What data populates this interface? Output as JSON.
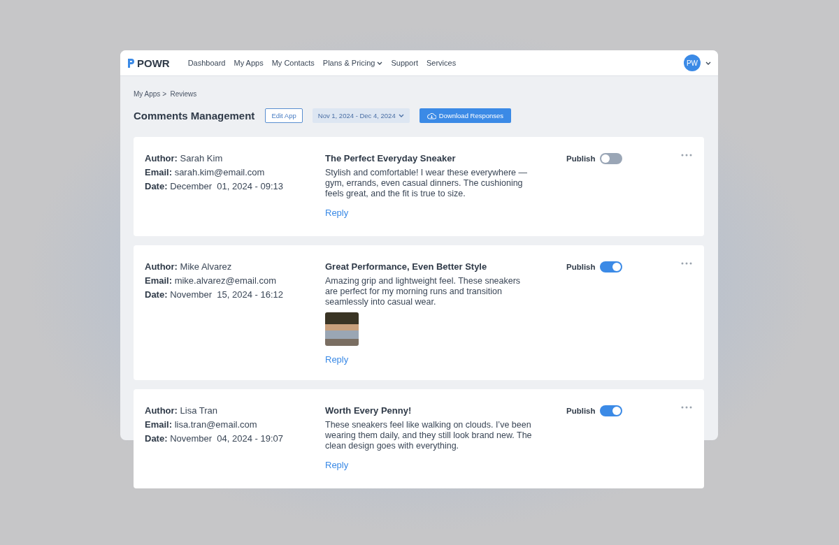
{
  "nav": {
    "logo": "POWR",
    "links": [
      {
        "label": "Dashboard",
        "dropdown": false
      },
      {
        "label": "My Apps",
        "dropdown": false
      },
      {
        "label": "My Contacts",
        "dropdown": false
      },
      {
        "label": "Plans & Pricing",
        "dropdown": true
      },
      {
        "label": "Support",
        "dropdown": false
      },
      {
        "label": "Services",
        "dropdown": false
      }
    ],
    "avatar": "PW"
  },
  "breadcrumb": "My Apps >  Reviews",
  "header": {
    "title": "Comments Management",
    "edit_button": "Edit App",
    "date_range": "Nov 1, 2024 - Dec 4, 2024",
    "download_button": "Download Responses"
  },
  "reviews": [
    {
      "author": "**Author:** Sarah Kim",
      "email": "**Email:** sarah.kim@email.com",
      "date": "**Date:** December  01, 2024 - 09:13",
      "title": "The Perfect Everyday Sneaker",
      "body": "Stylish and comfortable! I wear these everywhere —gym, errands, even casual dinners. The cushioning feels great, and the fit is true to size.",
      "has_photo": false,
      "reply": "Reply",
      "publish_label": "Publish",
      "published": false
    },
    {
      "author": "**Author:** Mike Alvarez",
      "email": "**Email:** mike.alvarez@email.com",
      "date": "**Date:** November  15, 2024 - 16:12",
      "title": "Great Performance, Even Better Style",
      "body": "Amazing grip and lightweight feel. These sneakers are perfect for my morning runs and transition seamlessly into casual wear.",
      "has_photo": true,
      "reply": "Reply",
      "publish_label": "Publish",
      "published": true
    },
    {
      "author": "**Author:** Lisa Tran",
      "email": "**Email:** lisa.tran@email.com",
      "date": "**Date:** November  04, 2024 - 19:07",
      "title": "Worth Every Penny!",
      "body": "These sneakers feel like walking on clouds. I’ve been wearing them daily, and they still look brand new. The clean design goes with everything.",
      "has_photo": false,
      "reply": "Reply",
      "publish_label": "Publish",
      "published": true
    }
  ]
}
